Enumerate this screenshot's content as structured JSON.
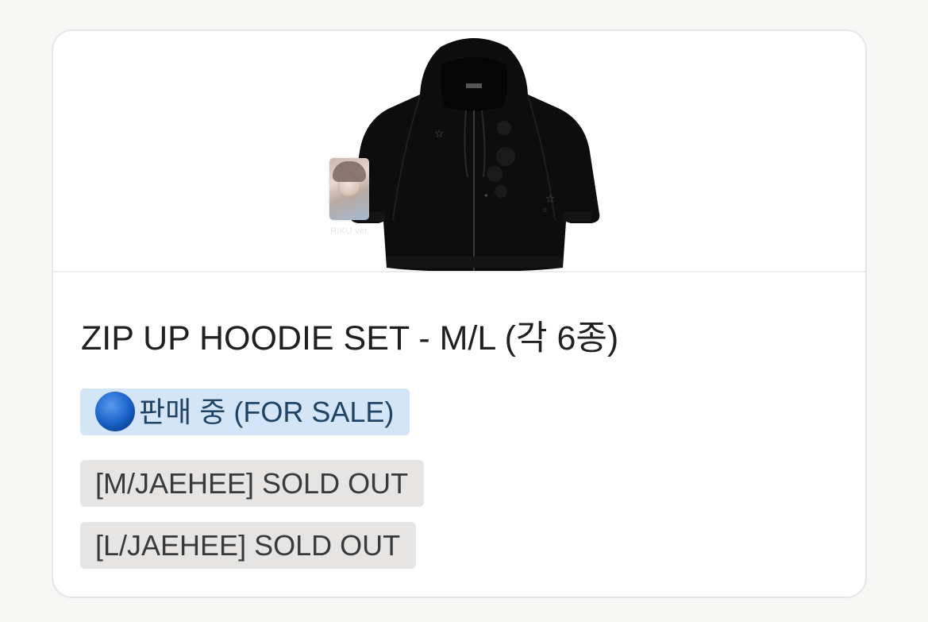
{
  "product": {
    "title": "ZIP UP HOODIE SET - M/L (각 6종)",
    "photocard_caption": "RIKU ver."
  },
  "status_badge": {
    "icon": "blue-circle-icon",
    "label": "판매 중 (FOR SALE)",
    "color": "#d3e5f7"
  },
  "stock_badges": [
    {
      "label": "[M/JAEHEE] SOLD OUT"
    },
    {
      "label": "[L/JAEHEE] SOLD OUT"
    }
  ],
  "colors": {
    "sale_badge_bg": "#d3e5f7",
    "soldout_badge_bg": "#e6e5e4",
    "dot": "#1a63c9"
  }
}
